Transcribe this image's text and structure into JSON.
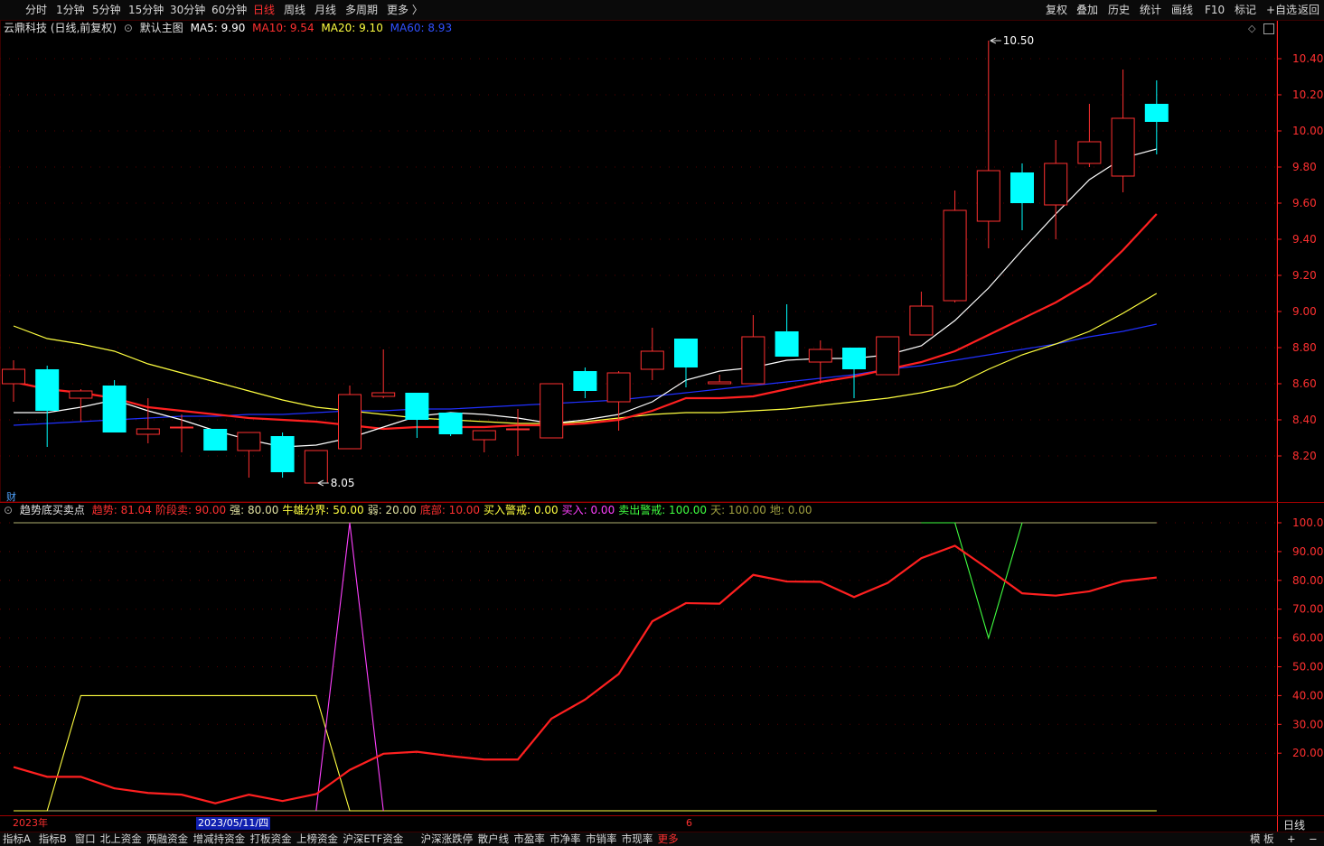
{
  "topbar": {
    "periods": [
      "分时",
      "1分钟",
      "5分钟",
      "15分钟",
      "30分钟",
      "60分钟",
      "日线",
      "周线",
      "月线",
      "多周期",
      "更多 〉"
    ],
    "active_period": "日线",
    "right_buttons": [
      "复权",
      "叠加",
      "历史",
      "统计",
      "画线",
      "F10",
      "标记",
      "+自选",
      "返回"
    ]
  },
  "main_info": {
    "stock": "云鼎科技 (日线,前复权)",
    "template": "默认主图",
    "ma5_label": "MA5: 9.90",
    "ma10_label": "MA10: 9.54",
    "ma20_label": "MA20: 9.10",
    "ma60_label": "MA60: 8.93"
  },
  "sub_info": {
    "name": "趋势底买卖点",
    "items": [
      {
        "text": "趋势: 81.04",
        "color": "#ff3030"
      },
      {
        "text": "阶段卖: 90.00",
        "color": "#ff3030"
      },
      {
        "text": "强: 80.00",
        "color": "#e0e0a0"
      },
      {
        "text": "牛雄分界: 50.00",
        "color": "#ffff40"
      },
      {
        "text": "弱: 20.00",
        "color": "#e0e0a0"
      },
      {
        "text": "底部: 10.00",
        "color": "#ff3030"
      },
      {
        "text": "买入警戒: 0.00",
        "color": "#ffff40"
      },
      {
        "text": "买入: 0.00",
        "color": "#ff40ff"
      },
      {
        "text": "卖出警戒: 100.00",
        "color": "#40ff40"
      },
      {
        "text": "天: 100.00",
        "color": "#a0a040"
      },
      {
        "text": "地: 0.00",
        "color": "#a0a040"
      }
    ]
  },
  "cai_label": "财",
  "date_bar": {
    "year": "2023年",
    "cursor_date": "2023/05/11/四",
    "month_mark": "6"
  },
  "period_label": "日线",
  "bottom_tabs": [
    "指标A",
    "指标B",
    "窗口",
    "北上资金",
    "两融资金",
    "增减持资金",
    "打板资金",
    "上榜资金",
    "沪深ETF资金",
    "沪深涨跌停",
    "散户线",
    "市盈率",
    "市净率",
    "市销率",
    "市现率",
    "更多"
  ],
  "bottom_right": [
    "模 板",
    "+",
    "−"
  ],
  "colors": {
    "up": "#ff3030",
    "down": "#00ffff",
    "ma5": "#ffffff",
    "ma10": "#ff2020",
    "ma20": "#ffff40",
    "ma60": "#2030ff",
    "axis": "#ff2020"
  },
  "chart_data": [
    {
      "type": "candlestick",
      "title": "云鼎科技 (日线,前复权)",
      "ylim": [
        8.05,
        10.5
      ],
      "yticks": [
        8.2,
        8.4,
        8.6,
        8.8,
        9.0,
        9.2,
        9.4,
        9.6,
        9.8,
        10.0,
        10.2,
        10.4
      ],
      "annotations": [
        {
          "text": "10.50",
          "price": 10.5,
          "bar": 29
        },
        {
          "text": "8.05",
          "price": 8.05,
          "bar": 9
        }
      ],
      "candles": [
        {
          "o": 8.6,
          "c": 8.68,
          "h": 8.73,
          "l": 8.5
        },
        {
          "o": 8.68,
          "c": 8.45,
          "h": 8.7,
          "l": 8.25
        },
        {
          "o": 8.52,
          "c": 8.56,
          "h": 8.57,
          "l": 8.39
        },
        {
          "o": 8.59,
          "c": 8.33,
          "h": 8.62,
          "l": 8.33
        },
        {
          "o": 8.32,
          "c": 8.35,
          "h": 8.52,
          "l": 8.27
        },
        {
          "o": 8.36,
          "c": 8.36,
          "h": 8.43,
          "l": 8.22
        },
        {
          "o": 8.35,
          "c": 8.23,
          "h": 8.35,
          "l": 8.23
        },
        {
          "o": 8.23,
          "c": 8.33,
          "h": 8.33,
          "l": 8.08
        },
        {
          "o": 8.31,
          "c": 8.11,
          "h": 8.33,
          "l": 8.08
        },
        {
          "o": 8.05,
          "c": 8.23,
          "h": 8.23,
          "l": 8.05
        },
        {
          "o": 8.24,
          "c": 8.54,
          "h": 8.59,
          "l": 8.24
        },
        {
          "o": 8.53,
          "c": 8.55,
          "h": 8.79,
          "l": 8.52
        },
        {
          "o": 8.55,
          "c": 8.4,
          "h": 8.55,
          "l": 8.3
        },
        {
          "o": 8.44,
          "c": 8.32,
          "h": 8.44,
          "l": 8.31
        },
        {
          "o": 8.29,
          "c": 8.34,
          "h": 8.34,
          "l": 8.22
        },
        {
          "o": 8.35,
          "c": 8.35,
          "h": 8.46,
          "l": 8.2
        },
        {
          "o": 8.3,
          "c": 8.6,
          "h": 8.6,
          "l": 8.3
        },
        {
          "o": 8.67,
          "c": 8.56,
          "h": 8.69,
          "l": 8.52
        },
        {
          "o": 8.5,
          "c": 8.66,
          "h": 8.67,
          "l": 8.34
        },
        {
          "o": 8.68,
          "c": 8.78,
          "h": 8.91,
          "l": 8.62
        },
        {
          "o": 8.85,
          "c": 8.69,
          "h": 8.85,
          "l": 8.58
        },
        {
          "o": 8.6,
          "c": 8.61,
          "h": 8.65,
          "l": 8.6
        },
        {
          "o": 8.6,
          "c": 8.86,
          "h": 8.98,
          "l": 8.6
        },
        {
          "o": 8.89,
          "c": 8.75,
          "h": 9.04,
          "l": 8.75
        },
        {
          "o": 8.72,
          "c": 8.79,
          "h": 8.84,
          "l": 8.6
        },
        {
          "o": 8.8,
          "c": 8.68,
          "h": 8.8,
          "l": 8.52
        },
        {
          "o": 8.65,
          "c": 8.86,
          "h": 8.86,
          "l": 8.65
        },
        {
          "o": 8.87,
          "c": 9.03,
          "h": 9.11,
          "l": 8.87
        },
        {
          "o": 9.06,
          "c": 9.56,
          "h": 9.67,
          "l": 9.05
        },
        {
          "o": 9.5,
          "c": 9.78,
          "h": 10.5,
          "l": 9.35
        },
        {
          "o": 9.77,
          "c": 9.6,
          "h": 9.82,
          "l": 9.45
        },
        {
          "o": 9.59,
          "c": 9.82,
          "h": 9.95,
          "l": 9.4
        },
        {
          "o": 9.82,
          "c": 9.94,
          "h": 10.15,
          "l": 9.8
        },
        {
          "o": 9.75,
          "c": 10.07,
          "h": 10.34,
          "l": 9.66
        },
        {
          "o": 10.15,
          "c": 10.05,
          "h": 10.28,
          "l": 9.87
        }
      ],
      "ma5": [
        8.44,
        8.44,
        8.47,
        8.51,
        8.45,
        8.4,
        8.34,
        8.29,
        8.25,
        8.26,
        8.3,
        8.36,
        8.42,
        8.44,
        8.43,
        8.41,
        8.38,
        8.4,
        8.43,
        8.5,
        8.62,
        8.67,
        8.69,
        8.73,
        8.74,
        8.74,
        8.76,
        8.81,
        8.95,
        9.13,
        9.34,
        9.54,
        9.73,
        9.85,
        9.9
      ],
      "ma10": [
        8.61,
        8.57,
        8.55,
        8.52,
        8.47,
        8.45,
        8.43,
        8.41,
        8.4,
        8.39,
        8.37,
        8.35,
        8.36,
        8.36,
        8.36,
        8.37,
        8.37,
        8.38,
        8.4,
        8.45,
        8.52,
        8.52,
        8.53,
        8.57,
        8.61,
        8.64,
        8.68,
        8.72,
        8.78,
        8.87,
        8.96,
        9.05,
        9.16,
        9.34,
        9.54
      ],
      "ma20": [
        8.92,
        8.85,
        8.82,
        8.78,
        8.71,
        8.66,
        8.61,
        8.56,
        8.51,
        8.47,
        8.45,
        8.43,
        8.41,
        8.4,
        8.39,
        8.38,
        8.38,
        8.39,
        8.41,
        8.43,
        8.44,
        8.44,
        8.45,
        8.46,
        8.48,
        8.5,
        8.52,
        8.55,
        8.59,
        8.68,
        8.76,
        8.82,
        8.89,
        8.99,
        9.1
      ],
      "ma60": [
        8.37,
        8.38,
        8.39,
        8.4,
        8.41,
        8.42,
        8.42,
        8.43,
        8.43,
        8.44,
        8.45,
        8.45,
        8.46,
        8.46,
        8.47,
        8.48,
        8.49,
        8.5,
        8.51,
        8.53,
        8.55,
        8.57,
        8.59,
        8.61,
        8.63,
        8.65,
        8.68,
        8.7,
        8.73,
        8.76,
        8.79,
        8.82,
        8.86,
        8.89,
        8.93
      ]
    },
    {
      "type": "line",
      "title": "趋势底买卖点",
      "ylim": [
        0,
        100
      ],
      "yticks": [
        20,
        30,
        40,
        50,
        60,
        70,
        80,
        90,
        100
      ],
      "series": [
        {
          "name": "趋势",
          "color": "#ff2020",
          "values": [
            15.2,
            11.8,
            11.8,
            7.8,
            6.2,
            5.6,
            2.6,
            5.6,
            3.4,
            5.8,
            14.2,
            19.8,
            20.5,
            19.0,
            17.8,
            17.8,
            32.0,
            38.6,
            47.5,
            65.8,
            72.1,
            71.9,
            81.9,
            79.6,
            79.5,
            74.2,
            79.1,
            87.7,
            92.0,
            83.9,
            75.5,
            74.7,
            76.2,
            79.7,
            81.0
          ]
        },
        {
          "name": "卖出警戒",
          "color": "#40ff40",
          "values": [
            null,
            null,
            null,
            null,
            null,
            null,
            null,
            null,
            null,
            null,
            null,
            null,
            null,
            null,
            null,
            null,
            null,
            null,
            null,
            null,
            null,
            null,
            null,
            null,
            null,
            null,
            null,
            100,
            100,
            60,
            100,
            null,
            null,
            null,
            null
          ]
        },
        {
          "name": "买入",
          "color": "#ff40ff",
          "values": [
            null,
            null,
            null,
            null,
            null,
            null,
            null,
            null,
            null,
            0,
            100,
            0,
            null,
            null,
            null,
            null,
            null,
            null,
            null,
            null,
            null,
            null,
            null,
            null,
            null,
            null,
            null,
            null,
            null,
            null,
            null,
            null,
            null,
            null,
            null
          ]
        },
        {
          "name": "买入警戒",
          "color": "#ffff40",
          "values": [
            0,
            0,
            40,
            40,
            40,
            40,
            40,
            40,
            40,
            40,
            0,
            0,
            0,
            0,
            0,
            0,
            0,
            0,
            0,
            0,
            0,
            0,
            0,
            0,
            0,
            0,
            0,
            0,
            0,
            0,
            0,
            0,
            0,
            0,
            0
          ]
        },
        {
          "name": "天",
          "color": "#b0b070",
          "values": [
            100,
            100,
            100,
            100,
            100,
            100,
            100,
            100,
            100,
            100,
            100,
            100,
            100,
            100,
            100,
            100,
            100,
            100,
            100,
            100,
            100,
            100,
            100,
            100,
            100,
            100,
            100,
            100,
            100,
            100,
            100,
            100,
            100,
            100,
            100
          ]
        },
        {
          "name": "地",
          "color": "#b0b070",
          "values": [
            0,
            0,
            0,
            0,
            0,
            0,
            0,
            0,
            0,
            0,
            0,
            0,
            0,
            0,
            0,
            0,
            0,
            0,
            0,
            0,
            0,
            0,
            0,
            0,
            0,
            0,
            0,
            0,
            0,
            0,
            0,
            0,
            0,
            0,
            0
          ]
        }
      ]
    }
  ]
}
